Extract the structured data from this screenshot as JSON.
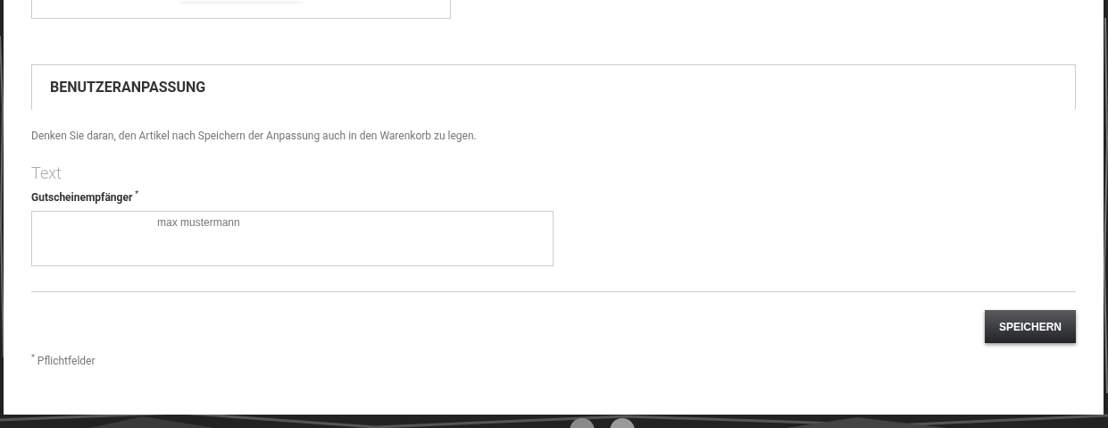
{
  "section": {
    "title": "BENUTZERANPASSUNG"
  },
  "notice": "Denken Sie daran, den Artikel nach Speichern der Anpassung auch in den Warenkorb zu legen.",
  "option": {
    "heading": "Text",
    "label": "Gutscheinempfänger $^{*}$",
    "value": "max mustermann"
  },
  "buttons": [
    {
      "label": "SPEICHERN"
    }
  ],
  "footnote": "$^{*}$ Pflichtfelder"
}
